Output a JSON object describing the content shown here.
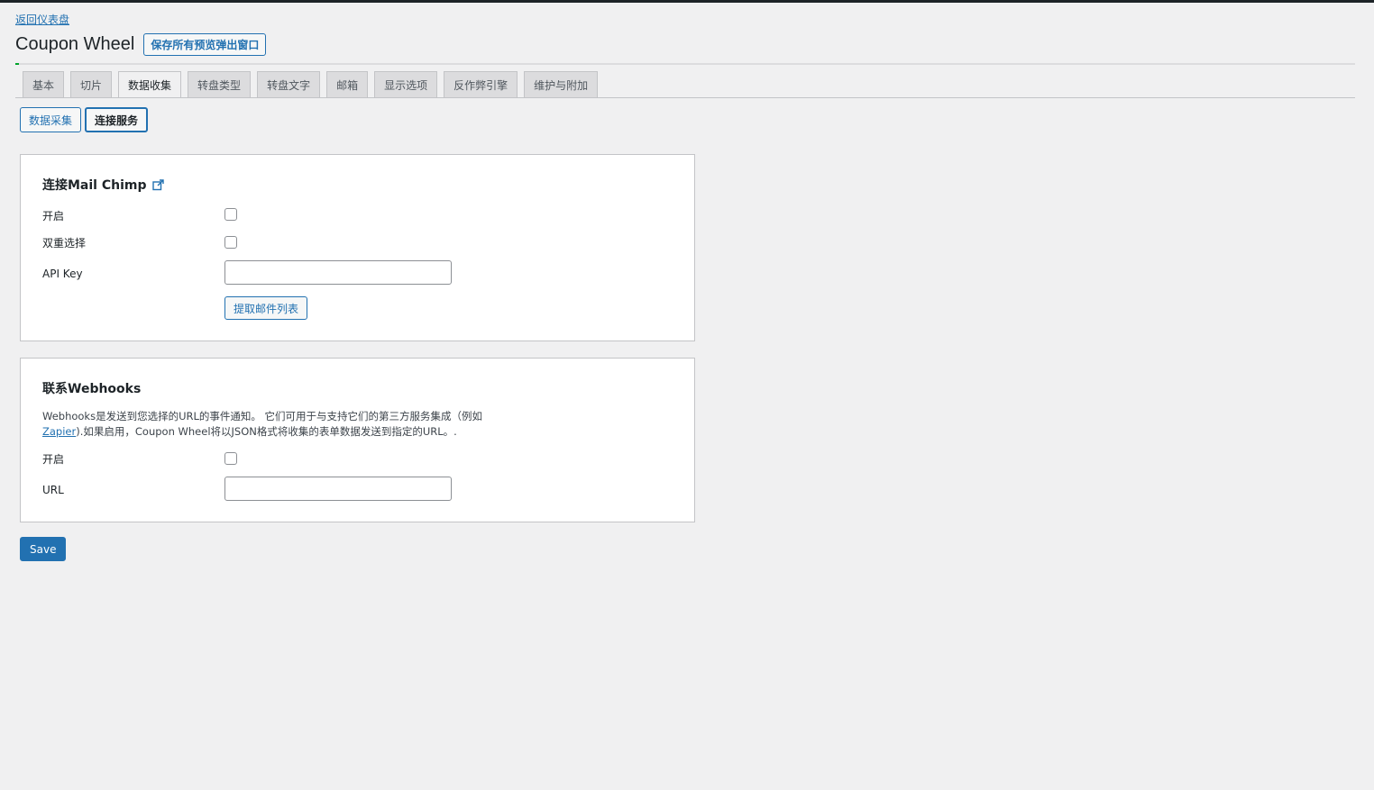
{
  "header": {
    "back_link": "返回仪表盘",
    "title": "Coupon Wheel",
    "save_all_button": "保存所有预览弹出窗口"
  },
  "tabs": [
    {
      "label": "基本",
      "active": false
    },
    {
      "label": "切片",
      "active": false
    },
    {
      "label": "数据收集",
      "active": true
    },
    {
      "label": "转盘类型",
      "active": false
    },
    {
      "label": "转盘文字",
      "active": false
    },
    {
      "label": "邮箱",
      "active": false
    },
    {
      "label": "显示选项",
      "active": false
    },
    {
      "label": "反作弊引擎",
      "active": false
    },
    {
      "label": "维护与附加",
      "active": false
    }
  ],
  "subtabs": [
    {
      "label": "数据采集",
      "active": false
    },
    {
      "label": "连接服务",
      "active": true
    }
  ],
  "mailchimp": {
    "heading": "连接Mail Chimp",
    "enable_label": "开启",
    "enable_checked": false,
    "double_optin_label": "双重选择",
    "double_optin_checked": false,
    "api_key_label": "API Key",
    "api_key_value": "",
    "fetch_button": "提取邮件列表"
  },
  "webhooks": {
    "heading": "联系Webhooks",
    "desc_part1": "Webhooks是发送到您选择的URL的事件通知。 它们可用于与支持它们的第三方服务集成（例如",
    "desc_link": "Zapier",
    "desc_part2": ").如果启用，Coupon Wheel将以JSON格式将收集的表单数据发送到指定的URL。.",
    "enable_label": "开启",
    "enable_checked": false,
    "url_label": "URL",
    "url_value": ""
  },
  "footer": {
    "save_button": "Save"
  },
  "colors": {
    "accent": "#2271b1",
    "background": "#f0f0f1",
    "panel": "#ffffff"
  }
}
